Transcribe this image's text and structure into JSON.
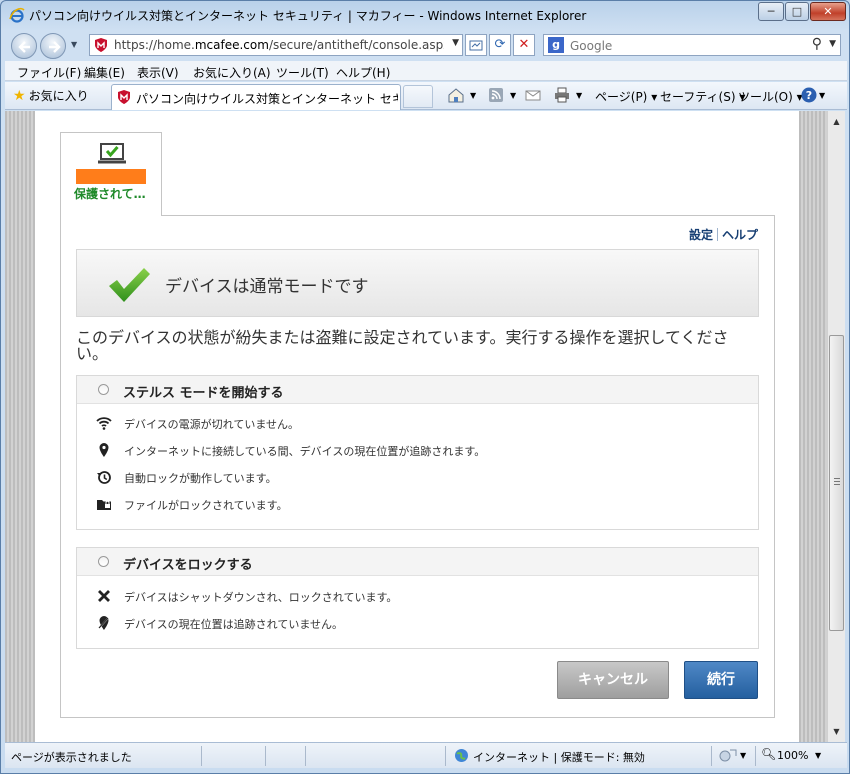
{
  "window": {
    "title": "パソコン向けウイルス対策とインターネット セキュリティ | マカフィー - Windows Internet Explorer",
    "minimize": "─",
    "maximize": "□",
    "close": "✕"
  },
  "addressbar": {
    "url_prefix": "https://home.",
    "url_domain": "mcafee.com",
    "url_rest": "/secure/antitheft/console.aspx?did=A(",
    "search_placeholder": "Google",
    "search_engine_letter": "g"
  },
  "menu": [
    "ファイル(F)",
    "編集(E)",
    "表示(V)",
    "お気に入り(A)",
    "ツール(T)",
    "ヘルプ(H)"
  ],
  "favbar": {
    "favorites": "お気に入り",
    "tab_title": "パソコン向けウイルス対策とインターネット セキュリティ | ...",
    "commands": [
      "ページ(P)",
      "セーフティ(S)",
      "ツール(O)"
    ]
  },
  "device": {
    "status": "保護されて…"
  },
  "panel": {
    "links": [
      "設定",
      "ヘルプ"
    ],
    "banner_message": "デバイスは通常モードです",
    "description": "このデバイスの状態が紛失または盗難に設定されています。実行する操作を選択してください。"
  },
  "options": [
    {
      "title": "ステルス モードを開始する",
      "features": [
        {
          "icon": "wifi-icon",
          "text": "デバイスの電源が切れていません。"
        },
        {
          "icon": "location-pin-icon",
          "text": "インターネットに接続している間、デバイスの現在位置が追跡されます。"
        },
        {
          "icon": "clock-history-icon",
          "text": "自動ロックが動作しています。"
        },
        {
          "icon": "folder-lock-icon",
          "text": "ファイルがロックされています。"
        }
      ]
    },
    {
      "title": "デバイスをロックする",
      "features": [
        {
          "icon": "x-mark-icon",
          "text": "デバイスはシャットダウンされ、ロックされています。"
        },
        {
          "icon": "location-pin-off-icon",
          "text": "デバイスの現在位置は追跡されていません。"
        }
      ]
    }
  ],
  "buttons": {
    "cancel": "キャンセル",
    "continue": "続行"
  },
  "statusbar": {
    "left": "ページが表示されました",
    "zone": "インターネット | 保護モード: 無効",
    "zoom": "100%"
  },
  "colors": {
    "accent_blue": "#2d69a8",
    "status_green": "#1f8a2a",
    "redaction_orange": "#ff7d1a"
  }
}
